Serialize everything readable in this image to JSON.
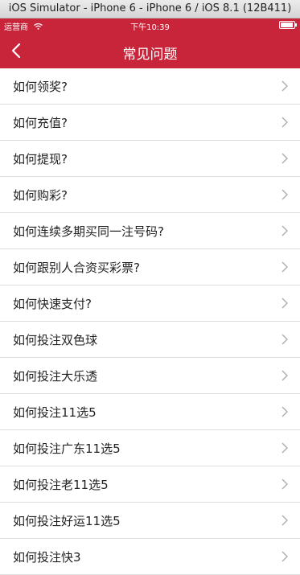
{
  "simulator": {
    "title": "iOS Simulator - iPhone 6 - iPhone 6 / iOS 8.1 (12B411)"
  },
  "status_bar": {
    "carrier": "运营商",
    "time": "下午10:39"
  },
  "nav": {
    "title": "常见问题",
    "back_icon": "chevron-left-icon"
  },
  "faq_items": [
    "如何领奖?",
    "如何充值?",
    "如何提现?",
    "如何购彩?",
    "如何连续多期买同一注号码?",
    "如何跟别人合资买彩票?",
    "如何快速支付?",
    "如何投注双色球",
    "如何投注大乐透",
    "如何投注11选5",
    "如何投注广东11选5",
    "如何投注老11选5",
    "如何投注好运11选5",
    "如何投注快3"
  ],
  "colors": {
    "accent": "#c8253a",
    "separator": "#dedede",
    "chevron": "#b0b0b0"
  }
}
